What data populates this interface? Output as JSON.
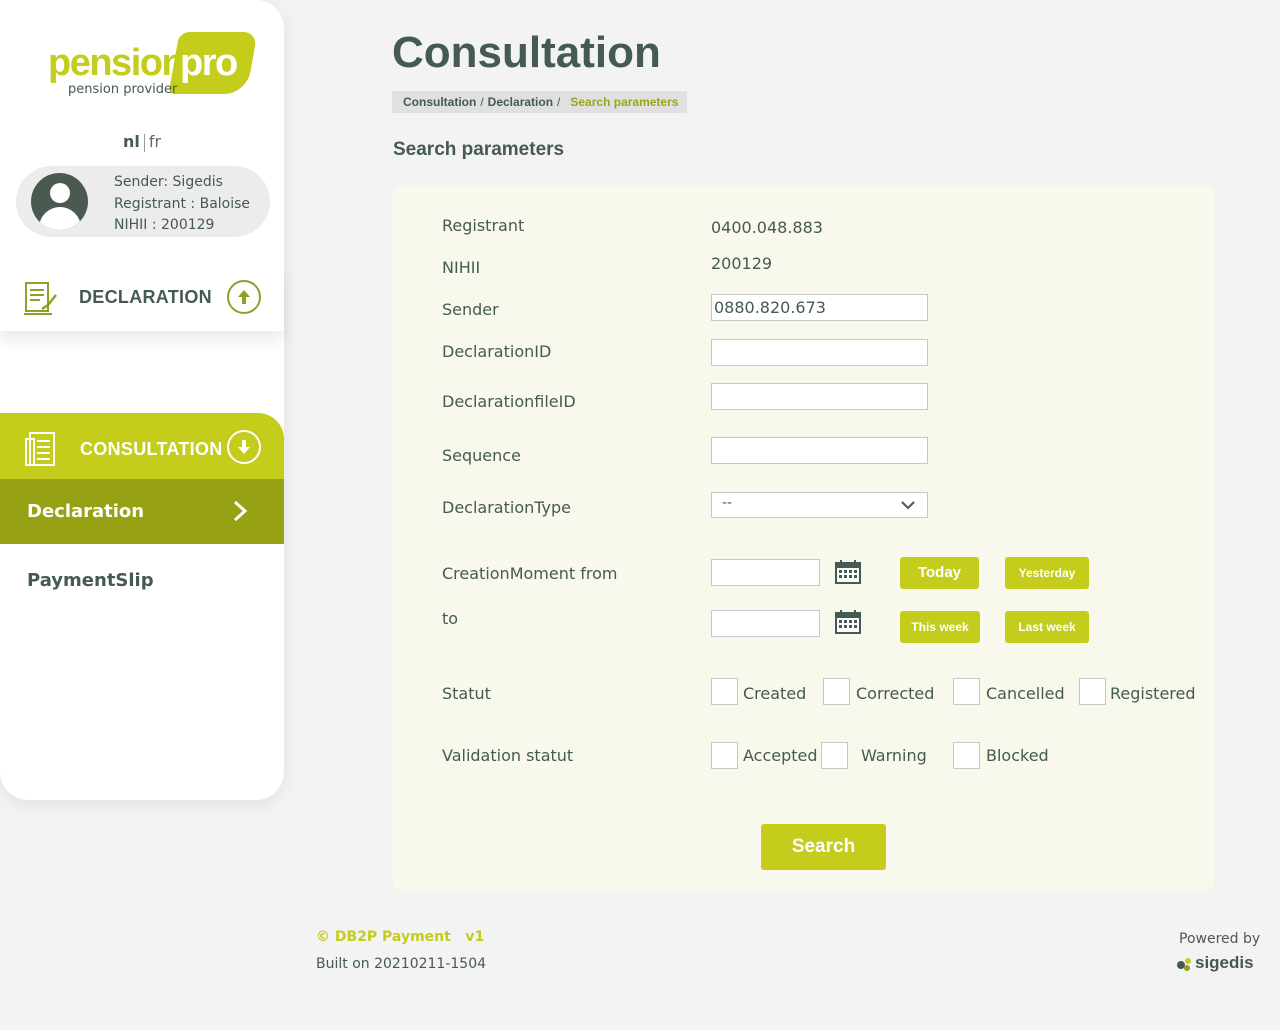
{
  "brand": {
    "logo_word": "pension",
    "logo_pro": "pro",
    "logo_sub": "pension provider"
  },
  "lang": {
    "nl": "nl",
    "fr": "fr"
  },
  "user": {
    "sender": "Sender: Sigedis",
    "registrant": "Registrant : Baloise",
    "nihii": "NIHII : 200129"
  },
  "sidebar": {
    "declaration": "DECLARATION",
    "consultation": "CONSULTATION",
    "items": [
      {
        "label": "Declaration",
        "active": true
      },
      {
        "label": "PaymentSlip",
        "active": false
      }
    ]
  },
  "page": {
    "title": "Consultation",
    "breadcrumb": [
      "Consultation",
      "Declaration",
      "Search parameters"
    ],
    "section_title": "Search parameters"
  },
  "form": {
    "registrant_label": "Registrant",
    "registrant_value": "0400.048.883",
    "nihii_label": "NIHII",
    "nihii_value": "200129",
    "sender_label": "Sender",
    "sender_value": "0880.820.673",
    "declarationid_label": "DeclarationID",
    "declarationid_value": "",
    "declarationfileid_label": "DeclarationfileID",
    "declarationfileid_value": "",
    "sequence_label": "Sequence",
    "sequence_value": "",
    "declarationtype_label": "DeclarationType",
    "declarationtype_value": "--",
    "creation_from_label": "CreationMoment from",
    "creation_to_label": "to",
    "btn_today": "Today",
    "btn_yesterday": "Yesterday",
    "btn_this_week": "This week",
    "btn_last_week": "Last week",
    "statut_label": "Statut",
    "statut_options": [
      "Created",
      "Corrected",
      "Cancelled",
      "Registered"
    ],
    "validation_label": "Validation statut",
    "validation_options": [
      "Accepted",
      "Warning",
      "Blocked"
    ],
    "search_label": "Search"
  },
  "footer": {
    "title": "© DB2P Payment   v1",
    "built": "Built on 20210211-1504",
    "powered": "Powered by",
    "sigedis": "sigedis"
  },
  "colors": {
    "accent": "#c4cc1c",
    "accent_dark": "#96a214",
    "text": "#455a50",
    "panel": "#f8f9ec"
  }
}
